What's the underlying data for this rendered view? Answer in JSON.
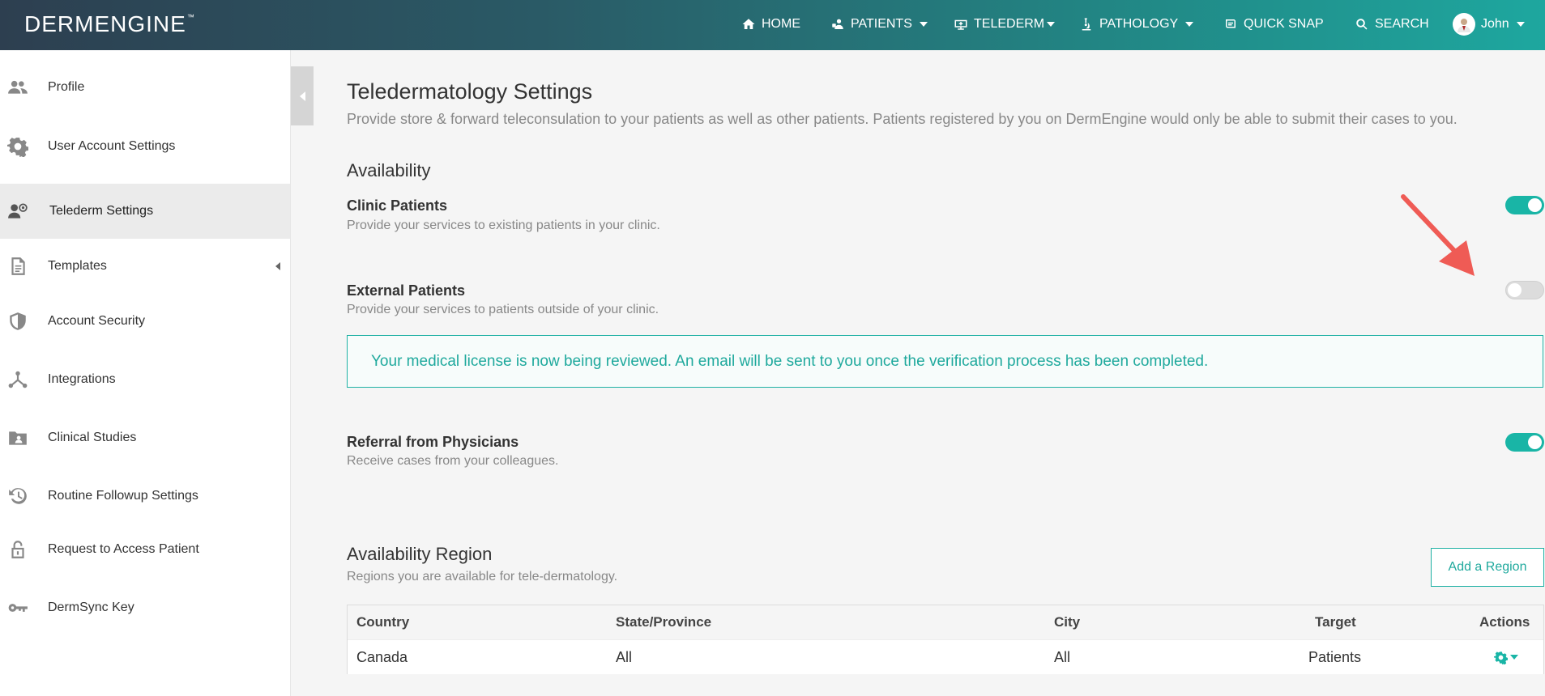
{
  "brand": {
    "light": "DERM",
    "bold": "ENGINE",
    "tm": "™"
  },
  "nav": {
    "home": "HOME",
    "patients": "PATIENTS",
    "telederm": "TELEDERM",
    "pathology": "PATHOLOGY",
    "quick_snap": "QUICK SNAP",
    "search": "SEARCH",
    "user": "John"
  },
  "sidebar": {
    "items": [
      {
        "label": "Profile",
        "icon": "users-icon"
      },
      {
        "label": "User Account Settings",
        "icon": "gear-icon"
      },
      {
        "label": "Telederm Settings",
        "icon": "telederm-icon",
        "active": true
      },
      {
        "label": "Templates",
        "icon": "document-icon"
      },
      {
        "label": "Account Security",
        "icon": "shield-icon"
      },
      {
        "label": "Integrations",
        "icon": "integrations-icon"
      },
      {
        "label": "Clinical Studies",
        "icon": "folder-user-icon"
      },
      {
        "label": "Routine Followup Settings",
        "icon": "history-icon"
      },
      {
        "label": "Request to Access Patient",
        "icon": "lock-icon"
      },
      {
        "label": "DermSync Key",
        "icon": "key-icon"
      }
    ]
  },
  "main": {
    "title": "Teledermatology Settings",
    "description": "Provide store & forward teleconsulation to your patients as well as other patients. Patients registered by you on DermEngine would only be able to submit their cases to you.",
    "availability": {
      "title": "Availability",
      "clinic": {
        "title": "Clinic Patients",
        "desc": "Provide your services to existing patients in your clinic.",
        "enabled": true
      },
      "external": {
        "title": "External Patients",
        "desc": "Provide your services to patients outside of your clinic.",
        "enabled": false
      },
      "notice": "Your medical license is now being reviewed. An email will be sent to you once the verification process has been completed.",
      "referral": {
        "title": "Referral from Physicians",
        "desc": "Receive cases from your colleagues.",
        "enabled": true
      }
    },
    "region": {
      "title": "Availability Region",
      "desc": "Regions you are available for tele-dermatology.",
      "add_button": "Add a Region",
      "columns": [
        "Country",
        "State/Province",
        "City",
        "Target",
        "Actions"
      ],
      "rows": [
        {
          "country": "Canada",
          "state": "All",
          "city": "All",
          "target": "Patients"
        }
      ]
    }
  },
  "colors": {
    "accent": "#19b5a6",
    "annotation_arrow": "#ef5b55"
  }
}
